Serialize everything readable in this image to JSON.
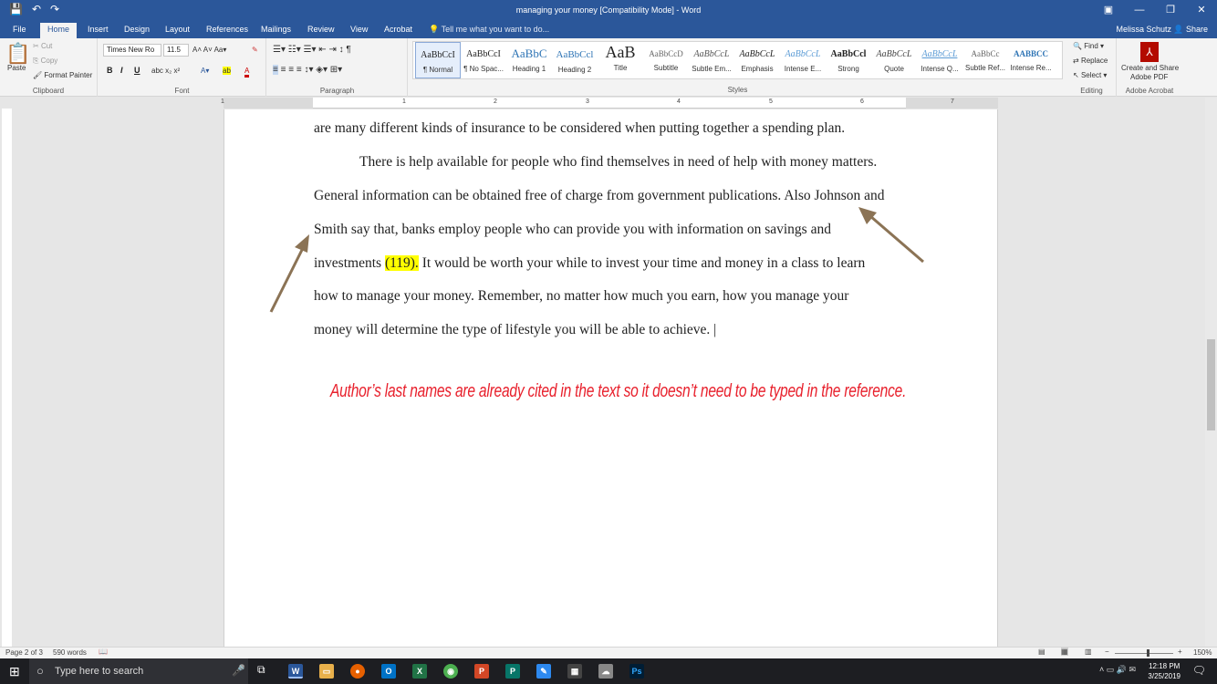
{
  "window": {
    "title": "managing your money [Compatibility Mode] - Word"
  },
  "tabs": [
    "File",
    "Home",
    "Insert",
    "Design",
    "Layout",
    "References",
    "Mailings",
    "Review",
    "View",
    "Acrobat"
  ],
  "tell_me": "Tell me what you want to do...",
  "user": "Melissa Schutz",
  "share": "Share",
  "clipboard": {
    "paste": "Paste",
    "cut": "Cut",
    "copy": "Copy",
    "format_painter": "Format Painter",
    "label": "Clipboard"
  },
  "font": {
    "name": "Times New Ro",
    "size": "11.5",
    "label": "Font"
  },
  "paragraph": {
    "label": "Paragraph"
  },
  "styles": {
    "label": "Styles",
    "items": [
      {
        "preview": "AaBbCcI",
        "name": "¶ Normal"
      },
      {
        "preview": "AaBbCcI",
        "name": "¶ No Spac..."
      },
      {
        "preview": "AaBbC",
        "name": "Heading 1"
      },
      {
        "preview": "AaBbCcl",
        "name": "Heading 2"
      },
      {
        "preview": "AaB",
        "name": "Title"
      },
      {
        "preview": "AaBbCcD",
        "name": "Subtitle"
      },
      {
        "preview": "AaBbCcL",
        "name": "Subtle Em..."
      },
      {
        "preview": "AaBbCcL",
        "name": "Emphasis"
      },
      {
        "preview": "AaBbCcL",
        "name": "Intense E..."
      },
      {
        "preview": "AaBbCcl",
        "name": "Strong"
      },
      {
        "preview": "AaBbCcL",
        "name": "Quote"
      },
      {
        "preview": "AaBbCcL",
        "name": "Intense Q..."
      },
      {
        "preview": "AaBbCc",
        "name": "Subtle Ref..."
      },
      {
        "preview": "AABBCC",
        "name": "Intense Re..."
      }
    ]
  },
  "editing": {
    "find": "Find",
    "replace": "Replace",
    "select": "Select",
    "label": "Editing"
  },
  "acrobat": {
    "create": "Create and Share",
    "pdf": "Adobe PDF",
    "label": "Adobe Acrobat"
  },
  "ruler_numbers": [
    "1",
    "1",
    "2",
    "3",
    "4",
    "5",
    "6",
    "7"
  ],
  "document": {
    "line1": "are many different kinds of insurance to be considered when putting together a spending plan.",
    "line2": "There is help available for people who find themselves in need of help with money matters.",
    "line3": "General information can be obtained free of charge from government publications. Also Johnson and",
    "line4": "Smith say that, banks employ people who can provide you with information on savings and",
    "line5a": "investments ",
    "line5hl": "(119).",
    "line5b": " It would be worth your while to invest your time and money in a class to learn",
    "line6": "how to manage your money. Remember, no matter how much you earn, how you manage your",
    "line7": "money will determine the type of lifestyle you will be able to achieve. |",
    "annotation": "Author’s last names are already cited in the text so it doesn’t need to be typed in the reference.",
    "arrow_color": "#8b7355",
    "annotation_color": "#e8202c"
  },
  "status": {
    "page": "Page 2 of 3",
    "words": "590 words",
    "zoom": "150%"
  },
  "taskbar": {
    "search": "Type here to search",
    "time": "12:18 PM",
    "date": "3/25/2019"
  }
}
